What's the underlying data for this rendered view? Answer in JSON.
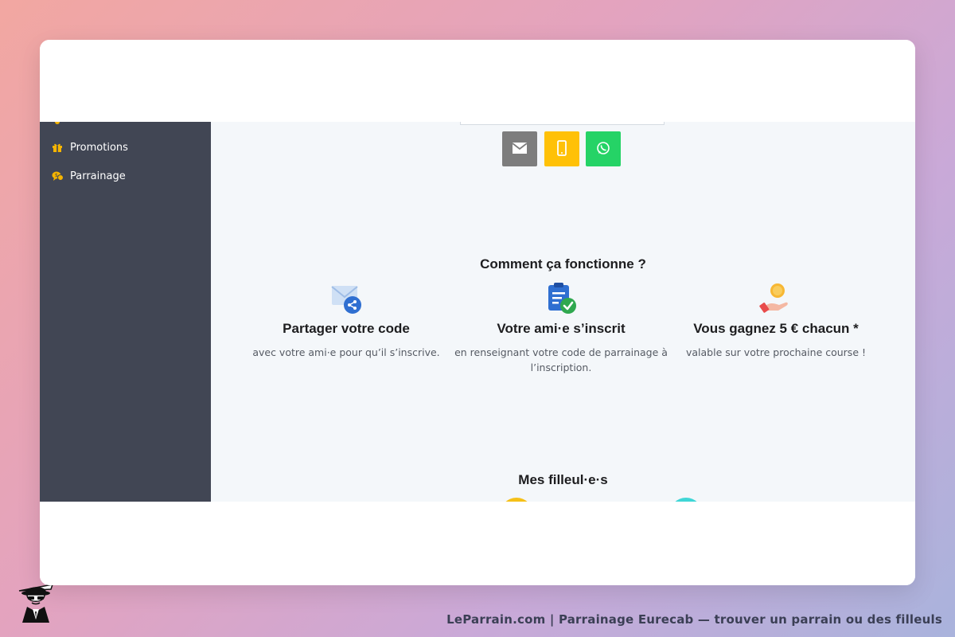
{
  "sidebar": {
    "items": [
      {
        "label": "Promotions",
        "icon": "gift-icon"
      },
      {
        "label": "Parrainage",
        "icon": "coins-chat-icon"
      }
    ]
  },
  "share": {
    "buttons": [
      {
        "icon": "envelope-icon",
        "color": "#7d7d7d"
      },
      {
        "icon": "mobile-phone-icon",
        "color": "#ffc107"
      },
      {
        "icon": "whatsapp-icon",
        "color": "#25d366"
      }
    ]
  },
  "how": {
    "title": "Comment ça fonctionne ?",
    "steps": [
      {
        "title": "Partager votre code",
        "desc": "avec votre ami·e pour qu’il s’inscrive.",
        "icon": "envelope-share-icon"
      },
      {
        "title": "Votre ami·e s’inscrit",
        "desc": "en renseignant votre code de parrainage à l’inscription.",
        "icon": "clipboard-check-icon"
      },
      {
        "title": "Vous gagnez 5 € chacun *",
        "desc": "valable sur votre prochaine course !",
        "icon": "hand-coin-icon"
      }
    ]
  },
  "referrals": {
    "title": "Mes filleul·e·s"
  },
  "footer": {
    "text": "LeParrain.com | Parrainage Eurecab — trouver un parrain ou des filleuls"
  }
}
